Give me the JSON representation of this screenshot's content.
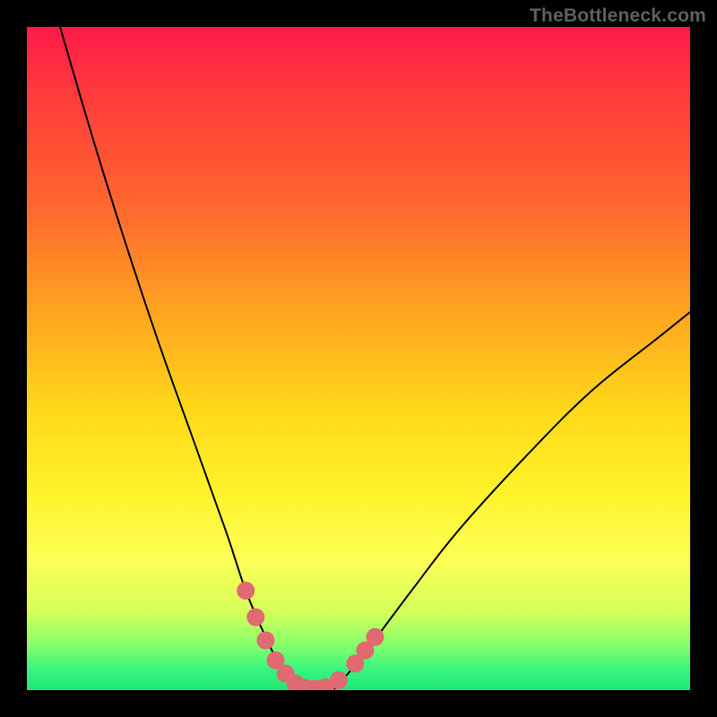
{
  "watermark": "TheBottleneck.com",
  "chart_data": {
    "type": "line",
    "title": "",
    "xlabel": "",
    "ylabel": "",
    "xlim": [
      0,
      100
    ],
    "ylim": [
      0,
      100
    ],
    "series": [
      {
        "name": "bottleneck-curve",
        "x": [
          5,
          10,
          15,
          20,
          25,
          30,
          33,
          36,
          38,
          40,
          42,
          44,
          46,
          48,
          52,
          58,
          65,
          75,
          85,
          95,
          100
        ],
        "y": [
          100,
          83,
          67,
          52,
          38,
          24,
          15,
          8,
          4,
          1,
          0,
          0,
          0,
          2,
          7,
          15,
          24,
          35,
          45,
          53,
          57
        ]
      }
    ],
    "markers": [
      {
        "name": "marker-left-1",
        "x": 33.0,
        "y": 15.0
      },
      {
        "name": "marker-left-2",
        "x": 34.5,
        "y": 11.0
      },
      {
        "name": "marker-left-3",
        "x": 36.0,
        "y": 7.5
      },
      {
        "name": "marker-left-4",
        "x": 37.5,
        "y": 4.5
      },
      {
        "name": "marker-left-5",
        "x": 39.0,
        "y": 2.5
      },
      {
        "name": "marker-bottom-1",
        "x": 40.5,
        "y": 1.0
      },
      {
        "name": "marker-bottom-2",
        "x": 42.0,
        "y": 0.3
      },
      {
        "name": "marker-bottom-3",
        "x": 43.5,
        "y": 0.2
      },
      {
        "name": "marker-bottom-4",
        "x": 45.0,
        "y": 0.4
      },
      {
        "name": "marker-right-1",
        "x": 47.0,
        "y": 1.5
      },
      {
        "name": "marker-right-2",
        "x": 49.5,
        "y": 4.0
      },
      {
        "name": "marker-right-3",
        "x": 51.0,
        "y": 6.0
      },
      {
        "name": "marker-right-4",
        "x": 52.5,
        "y": 8.0
      }
    ],
    "marker_color": "#e06972",
    "curve_color": "#000000"
  }
}
